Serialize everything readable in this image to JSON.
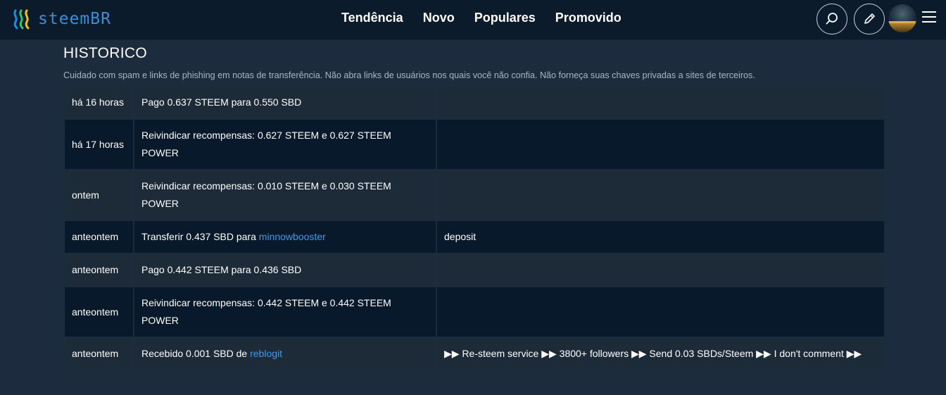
{
  "header": {
    "logo_text": "steemBR",
    "nav": [
      "Tendência",
      "Novo",
      "Populares",
      "Promovido"
    ],
    "icons": [
      "search-icon",
      "pencil-icon",
      "avatar",
      "hamburger-menu-icon"
    ]
  },
  "page": {
    "title": "HISTORICO",
    "warning": "Cuidado com spam e links de phishing em notas de transferência. Não abra links de usuários nos quais você não confia. Não forneça suas chaves privadas a sites de terceiros."
  },
  "colors": {
    "header_bg": "#0b1b2b",
    "page_bg": "#1c2b3d",
    "row_odd": "#1d2a38",
    "row_even": "#08192b",
    "link": "#3a9bf0",
    "logo": "#3a8fd6"
  },
  "history": [
    {
      "time": "há 16 horas",
      "op_text": "Pago 0.637 STEEM para 0.550 SBD",
      "memo": ""
    },
    {
      "time": "há 17 horas",
      "op_text": "Reivindicar recompensas: 0.627 STEEM e 0.627 STEEM POWER",
      "memo": ""
    },
    {
      "time": "ontem",
      "op_text": "Reivindicar recompensas: 0.010 STEEM e 0.030 STEEM POWER",
      "memo": ""
    },
    {
      "time": "anteontem",
      "op_text": "Transferir 0.437 SBD para ",
      "op_link": "minnowbooster",
      "memo": "deposit"
    },
    {
      "time": "anteontem",
      "op_text": "Pago 0.442 STEEM para 0.436 SBD",
      "memo": ""
    },
    {
      "time": "anteontem",
      "op_text": "Reivindicar recompensas: 0.442 STEEM e 0.442 STEEM POWER",
      "memo": ""
    },
    {
      "time": "anteontem",
      "op_text": "Recebido 0.001 SBD de ",
      "op_link": "reblogit",
      "memo": "▶▶ Re-steem service ▶▶ 3800+ followers ▶▶ Send 0.03 SBDs/Steem ▶▶ I don't comment ▶▶"
    }
  ]
}
